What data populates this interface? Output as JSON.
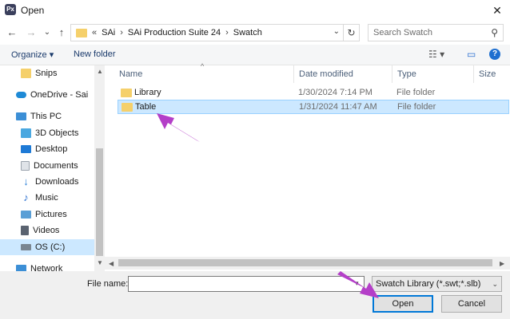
{
  "window": {
    "app_icon_text": "Px",
    "title": "Open",
    "close": "✕"
  },
  "nav": {
    "back": "←",
    "forward": "→",
    "dropdown": "⌄",
    "up": "↑",
    "address": {
      "prefix": "«",
      "segments": [
        "SAi",
        "SAi Production Suite 24",
        "Swatch"
      ],
      "separator": "›"
    },
    "refresh": "↻",
    "search_placeholder": "Search Swatch",
    "search_icon": "⚲"
  },
  "toolbar": {
    "organize": "Organize ▾",
    "new_folder": "New folder",
    "view_icon": "☷ ▾",
    "pane_icon": "▭",
    "help_icon": "?"
  },
  "sidebar": {
    "items": [
      {
        "label": "Snips",
        "icon": "folder-icon",
        "color": "#f5d06b"
      },
      {
        "label": "OneDrive - Sai",
        "icon": "cloud-icon",
        "color": "#1e8ad6"
      },
      {
        "label": "This PC",
        "icon": "computer-icon",
        "color": "#3c8fd6"
      },
      {
        "label": "3D Objects",
        "icon": "cube-icon",
        "color": "#4aa8e0"
      },
      {
        "label": "Desktop",
        "icon": "desktop-icon",
        "color": "#1e7ad6"
      },
      {
        "label": "Documents",
        "icon": "documents-icon",
        "color": "#9aa3ad"
      },
      {
        "label": "Downloads",
        "icon": "downloads-icon",
        "color": "#2a7fd6"
      },
      {
        "label": "Music",
        "icon": "music-icon",
        "color": "#2a6fd0"
      },
      {
        "label": "Pictures",
        "icon": "pictures-icon",
        "color": "#5a9fd6"
      },
      {
        "label": "Videos",
        "icon": "videos-icon",
        "color": "#5a6370"
      },
      {
        "label": "OS (C:)",
        "icon": "drive-icon",
        "color": "#7a8590"
      },
      {
        "label": "Network",
        "icon": "network-icon",
        "color": "#3c8fd6"
      }
    ]
  },
  "columns": {
    "name": "Name",
    "date": "Date modified",
    "type": "Type",
    "size": "Size"
  },
  "files": [
    {
      "name": "Library",
      "date": "1/30/2024 7:14 PM",
      "type": "File folder"
    },
    {
      "name": "Table",
      "date": "1/31/2024 11:47 AM",
      "type": "File folder"
    }
  ],
  "footer": {
    "file_name_label": "File name:",
    "file_name_value": "",
    "filter": "Swatch Library (*.swt;*.slb)",
    "open": "Open",
    "cancel": "Cancel"
  },
  "colors": {
    "selection": "#cce8ff",
    "arrow": "#b43fc8",
    "accent": "#0078d7"
  }
}
